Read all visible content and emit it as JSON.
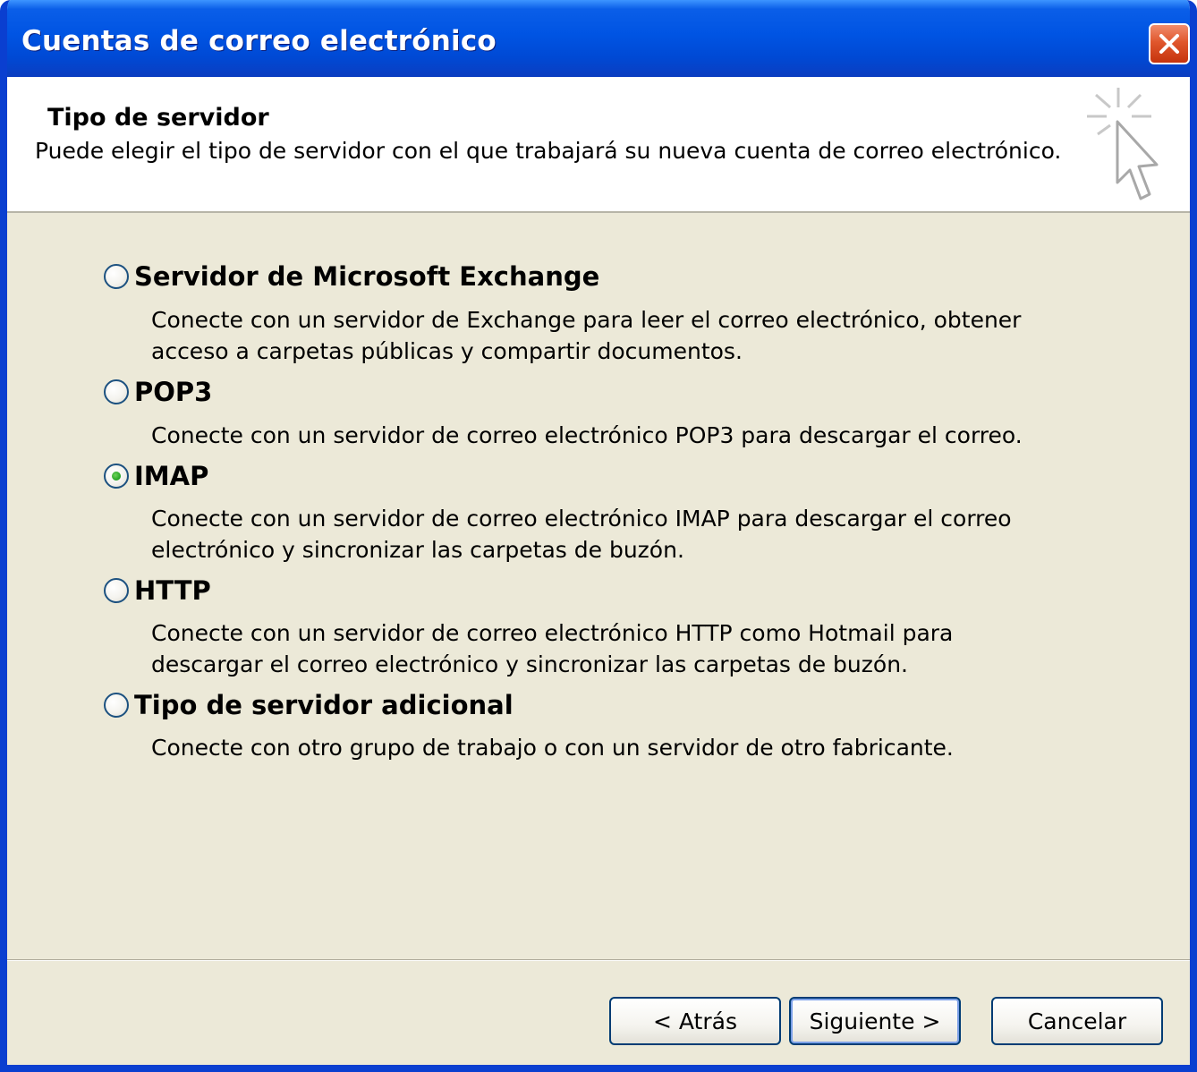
{
  "window": {
    "title": "Cuentas de correo electrónico"
  },
  "header": {
    "title": "Tipo de servidor",
    "description": "Puede elegir el tipo de servidor con el que trabajará su nueva cuenta de correo electrónico."
  },
  "options": [
    {
      "label": "Servidor de Microsoft Exchange",
      "desc1": "Conecte con un servidor de Exchange para leer el correo electrónico, obtener",
      "desc2": "acceso a carpetas públicas y compartir documentos.",
      "checked": false
    },
    {
      "label": "POP3",
      "desc1": "Conecte con un servidor de correo electrónico POP3 para descargar el correo.",
      "desc2": "",
      "checked": false
    },
    {
      "label": "IMAP",
      "desc1": "Conecte con un servidor de correo electrónico IMAP para descargar el correo",
      "desc2": "electrónico y sincronizar las carpetas de buzón.",
      "checked": true
    },
    {
      "label": "HTTP",
      "desc1": "Conecte con un servidor de correo electrónico HTTP como Hotmail para",
      "desc2": "descargar el correo electrónico y sincronizar las carpetas de buzón.",
      "checked": false
    },
    {
      "label": "Tipo de servidor adicional",
      "desc1": "Conecte con otro grupo de trabajo o con un servidor de otro fabricante.",
      "desc2": "",
      "checked": false
    }
  ],
  "buttons": {
    "back": "< Atrás",
    "next": "Siguiente >",
    "cancel": "Cancelar"
  }
}
